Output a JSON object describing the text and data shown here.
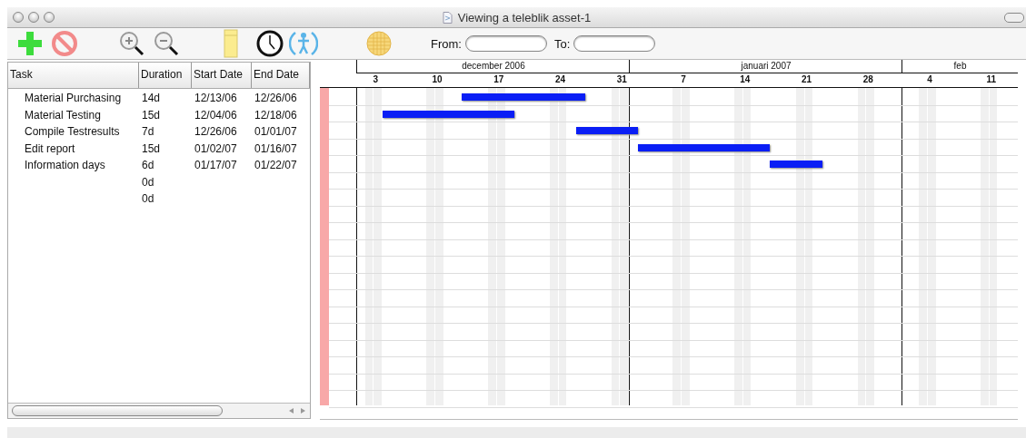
{
  "window": {
    "title": "Viewing a teleblik asset-1"
  },
  "toolbar": {
    "from_label": "From:",
    "to_label": "To:"
  },
  "table": {
    "columns": [
      "Task",
      "Duration",
      "Start Date",
      "End Date"
    ],
    "rows": [
      {
        "task": "Material Purchasing",
        "duration": "14d",
        "start": "12/13/06",
        "end": "12/26/06"
      },
      {
        "task": "Material Testing",
        "duration": "15d",
        "start": "12/04/06",
        "end": "12/18/06"
      },
      {
        "task": "Compile Testresults",
        "duration": "7d",
        "start": "12/26/06",
        "end": "01/01/07"
      },
      {
        "task": "Edit report",
        "duration": "15d",
        "start": "01/02/07",
        "end": "01/16/07"
      },
      {
        "task": "Information days",
        "duration": "6d",
        "start": "01/17/07",
        "end": "01/22/07"
      },
      {
        "duration": "0d"
      },
      {
        "duration": "0d"
      }
    ]
  },
  "timeline": {
    "months": [
      {
        "label": "december 2006"
      },
      {
        "label": "januari 2007"
      },
      {
        "label": "feb"
      }
    ],
    "day_ticks": [
      "3",
      "10",
      "17",
      "24",
      "31",
      "7",
      "14",
      "21",
      "28",
      "4",
      "11"
    ]
  }
}
